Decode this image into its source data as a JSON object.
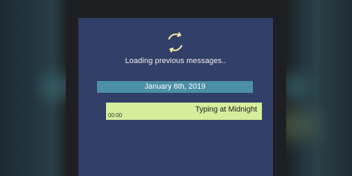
{
  "loading": {
    "text": "Loading previous messages.."
  },
  "date_separator": {
    "label": "January 6th, 2019"
  },
  "messages": [
    {
      "text": "Typing at Midnight",
      "time": "00:00"
    }
  ],
  "icons": {
    "spinner": "refresh-spinner-icon"
  },
  "colors": {
    "panel": "#323f68",
    "date_bar": "#4c8fa6",
    "message_bubble": "#d6ed9c",
    "spinner": "#f3e7a8"
  }
}
